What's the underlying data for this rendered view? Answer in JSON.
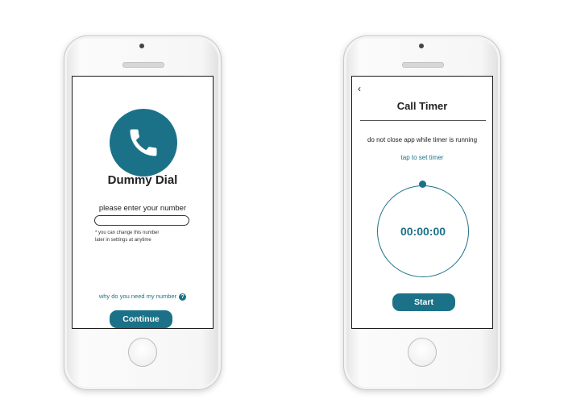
{
  "colors": {
    "accent": "#1b7288",
    "text": "#222222",
    "screen_bg": "#ffffff"
  },
  "screen_1": {
    "logo_icon": "phone-handset-icon",
    "app_name": "Dummy Dial",
    "prompt": "please enter your number",
    "input": {
      "value": "",
      "placeholder": ""
    },
    "hint_line_1": "* you can change this number",
    "hint_line_2": "later in settings at anytime",
    "why_link": "why do you need my number",
    "help_icon_glyph": "?",
    "continue_label": "Continue"
  },
  "screen_2": {
    "back_glyph": "‹",
    "title": "Call Timer",
    "warning": "do not close app while timer is running",
    "tap_link": "tap to set timer",
    "time": "00:00:00",
    "start_label": "Start"
  }
}
